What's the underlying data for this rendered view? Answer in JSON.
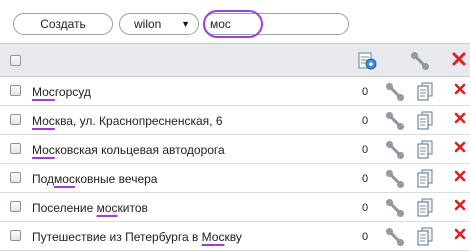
{
  "toolbar": {
    "create_label": "Создать",
    "account_value": "wilon",
    "search_value": "мос"
  },
  "rows": [
    {
      "pre": "",
      "hl": "Мос",
      "post": "горсуд",
      "count": "0"
    },
    {
      "pre": "",
      "hl": "Мос",
      "post": "ква, ул. Краснопресненская, 6",
      "count": "0"
    },
    {
      "pre": "",
      "hl": "Мос",
      "post": "ковская кольцевая автодорога",
      "count": "0"
    },
    {
      "pre": "Под",
      "hl": "мос",
      "post": "ковные вечера",
      "count": "0"
    },
    {
      "pre": "Поселение ",
      "hl": "мос",
      "post": "китов",
      "count": "0"
    },
    {
      "pre": "Путешествие из Петербурга в ",
      "hl": "Мос",
      "post": "кву",
      "count": "0"
    }
  ],
  "colors": {
    "highlight": "#9b3fd6",
    "delete": "#e02020",
    "header_bg": "#e7e9ec"
  },
  "icons": [
    "settings-doc-icon",
    "wrench-icon",
    "delete-icon",
    "document-icon",
    "dropdown-arrow-icon"
  ]
}
